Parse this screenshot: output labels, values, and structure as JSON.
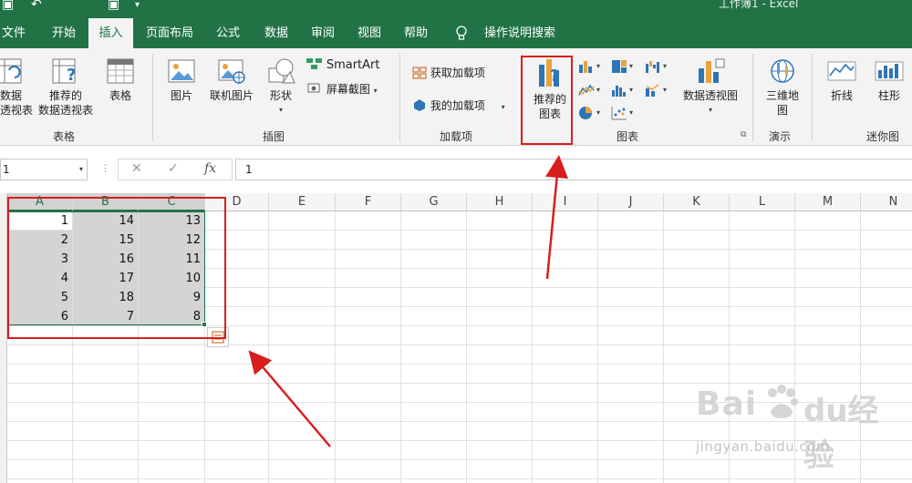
{
  "titlebar": {
    "doc_title": "工作簿1 - Excel"
  },
  "tabs": [
    "文件",
    "开始",
    "插入",
    "页面布局",
    "公式",
    "数据",
    "审阅",
    "视图",
    "帮助"
  ],
  "tell_me": "操作说明搜索",
  "ribbon": {
    "pivot_table": "数据\n透视表",
    "rec_pivot": "推荐的\n数据透视表",
    "table": "表格",
    "group_tables": "表格",
    "pictures": "图片",
    "online_pictures": "联机图片",
    "shapes": "形状",
    "smartart": "SmartArt",
    "screenshot": "屏幕截图",
    "group_illustrations": "插图",
    "get_addins": "获取加载项",
    "my_addins": "我的加载项",
    "group_addins": "加载项",
    "rec_charts": "推荐的\n图表",
    "pivot_chart": "数据透视图",
    "group_charts": "图表",
    "map3d": "三维地\n图",
    "group_tours": "演示",
    "spark_line": "折线",
    "spark_column": "柱形",
    "group_sparklines": "迷你图"
  },
  "formula_bar": {
    "name_box": "1",
    "fx": "fx",
    "value": "1"
  },
  "grid": {
    "columns": [
      "A",
      "B",
      "C",
      "D",
      "E",
      "F",
      "G",
      "H",
      "I",
      "J",
      "K",
      "L",
      "M",
      "N"
    ],
    "rows": [
      [
        1,
        14,
        13
      ],
      [
        2,
        15,
        12
      ],
      [
        3,
        16,
        11
      ],
      [
        4,
        17,
        10
      ],
      [
        5,
        18,
        9
      ],
      [
        6,
        7,
        8
      ]
    ]
  },
  "colors": {
    "excel_green": "#217346",
    "annotation_red": "#d81e1e"
  },
  "watermark": {
    "url": "jingyan.baidu.com"
  }
}
